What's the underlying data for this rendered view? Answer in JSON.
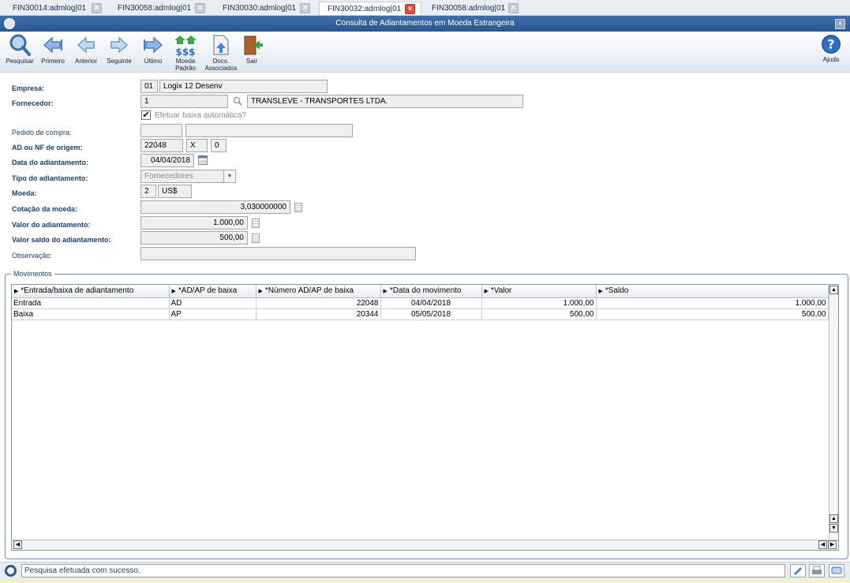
{
  "tabs": [
    {
      "label": "FIN30014:admlog|01",
      "active": false
    },
    {
      "label": "FIN30058:admlog|01",
      "active": false
    },
    {
      "label": "FIN30030:admlog|01",
      "active": false
    },
    {
      "label": "FIN30032:admlog|01",
      "active": true
    },
    {
      "label": "FIN30058:admlog|01",
      "active": false
    }
  ],
  "window": {
    "title": "Consulta de Adiantamentos em Moeda Estrangeira"
  },
  "toolbar": {
    "pesquisar": "Pesquisar",
    "primeiro": "Primeiro",
    "anterior": "Anterior",
    "seguinte": "Seguinte",
    "ultimo": "Último",
    "moeda_padrao_1": "Moeda",
    "moeda_padrao_2": "Padrão",
    "docs_1": "Docs.",
    "docs_2": "Associados",
    "sair": "Sair",
    "ajuda": "Ajuda"
  },
  "form": {
    "empresa_label": "Empresa:",
    "empresa_code": "01",
    "empresa_name": "Logix 12 Desenv",
    "fornecedor_label": "Fornecedor:",
    "fornecedor_code": "1",
    "fornecedor_name": "TRANSLEVE - TRANSPORTES LTDA.",
    "baixa_auto_label": "Efetuar baixa automática?",
    "baixa_auto_checked": true,
    "pedido_label": "Pedido de compra:",
    "pedido_code": "",
    "pedido_desc": "",
    "ad_nf_label": "AD ou NF de origem:",
    "ad_nf_num": "22048",
    "ad_nf_type": "X",
    "ad_nf_seq": "0",
    "data_adiant_label": "Data do adiantamento:",
    "data_adiant": "04/04/2018",
    "tipo_adiant_label": "Tipo do adiantamento:",
    "tipo_adiant": "Fornecedores",
    "moeda_label": "Moeda:",
    "moeda_code": "2",
    "moeda_name": "US$",
    "cotacao_label": "Cotação da moeda:",
    "cotacao": "3,030000000",
    "valor_adiant_label": "Valor do adiantamento:",
    "valor_adiant": "1.000,00",
    "saldo_adiant_label": "Valor saldo do adiantamento:",
    "saldo_adiant": "500,00",
    "observacao_label": "Observação:",
    "observacao": ""
  },
  "movimentos": {
    "group_title": "Movimentos",
    "columns": [
      "*Entrada/baixa de adiantamento",
      "*AD/AP de baixa",
      "*Número AD/AP de baixa",
      "*Data do movimento",
      "*Valor",
      "*Saldo"
    ],
    "rows": [
      [
        "Entrada",
        "AD",
        "22048",
        "04/04/2018",
        "1.000,00",
        "1.000,00"
      ],
      [
        "Baixa",
        "AP",
        "20344",
        "05/05/2018",
        "500,00",
        "500,00"
      ]
    ]
  },
  "status": {
    "message": "Pesquisa efetuada com sucesso."
  },
  "colors": {
    "titlebar": "#2a5791",
    "label": "#1d3d6e",
    "close_active": "#e34b3c"
  }
}
